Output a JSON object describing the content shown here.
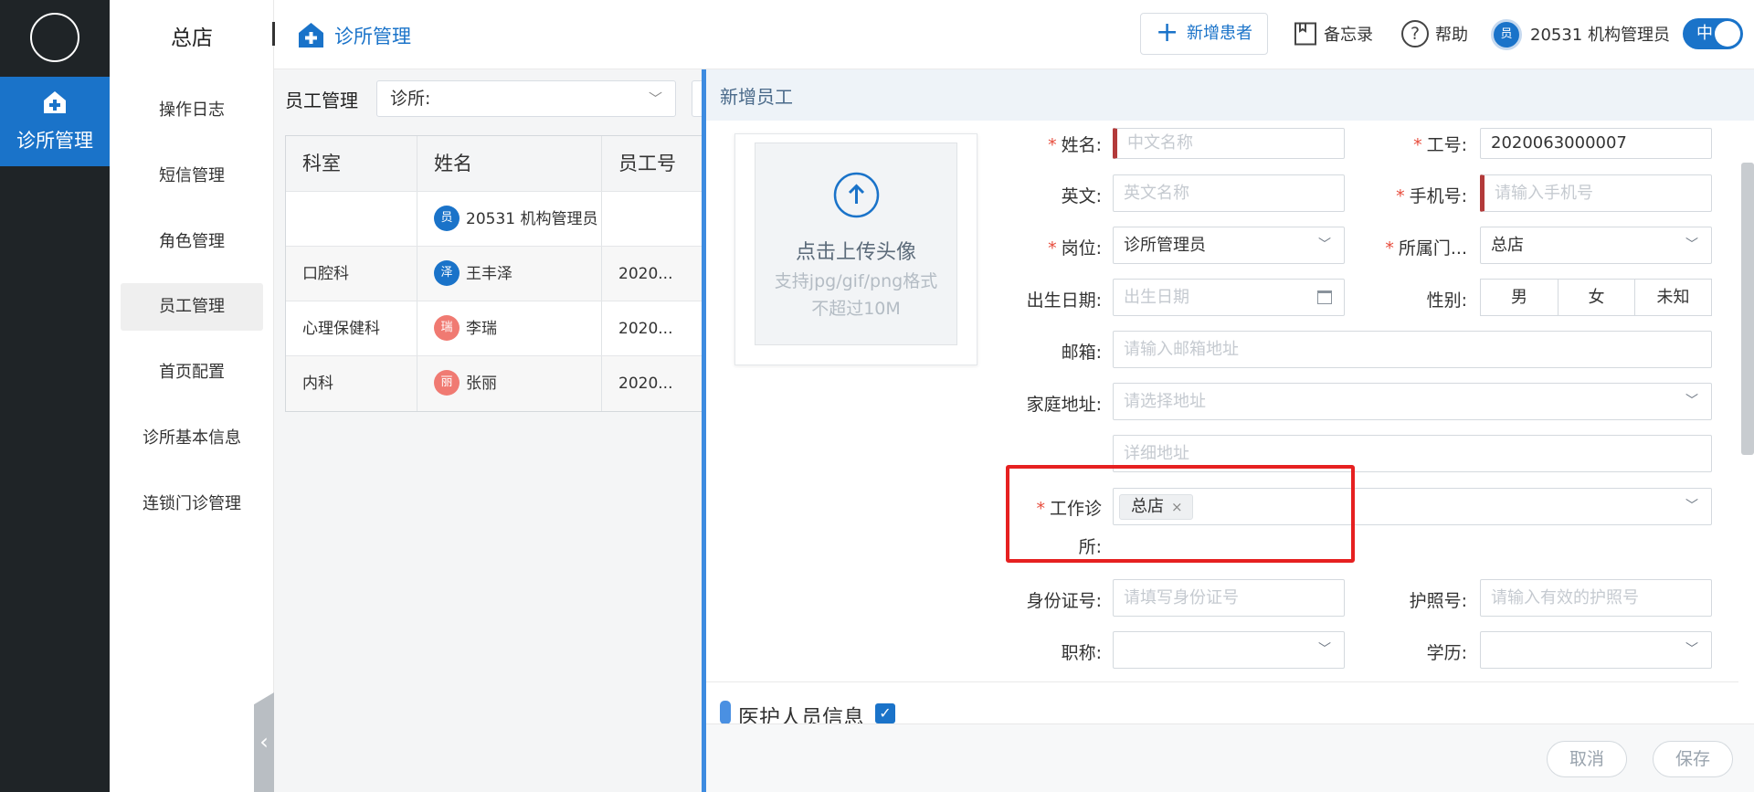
{
  "app": {
    "rail_active_label": "诊所管理",
    "store_name": "总店"
  },
  "sidebar": {
    "items": [
      {
        "label": "操作日志"
      },
      {
        "label": "短信管理"
      },
      {
        "label": "角色管理"
      },
      {
        "label": "员工管理",
        "active": true
      },
      {
        "label": "首页配置"
      },
      {
        "label": "诊所基本信息"
      },
      {
        "label": "连锁门诊管理"
      }
    ]
  },
  "header": {
    "breadcrumb": "诊所管理",
    "new_patient": "新增患者",
    "memo": "备忘录",
    "help": "帮助",
    "help_glyph": "?",
    "user_avatar": "员",
    "user": "20531 机构管理员",
    "lang": "中"
  },
  "staff_list": {
    "title": "员工管理",
    "clinic_filter": "诊所:",
    "columns": [
      "科室",
      "姓名",
      "员工号"
    ],
    "rows": [
      {
        "dept": "",
        "avatar": "员",
        "name": "20531 机构管理员",
        "id": ""
      },
      {
        "dept": "口腔科",
        "avatar": "泽",
        "name": "王丰泽",
        "id": "2020..."
      },
      {
        "dept": "心理保健科",
        "avatar": "瑞",
        "name": "李瑞",
        "id": "2020..."
      },
      {
        "dept": "内科",
        "avatar": "丽",
        "name": "张丽",
        "id": "2020..."
      }
    ]
  },
  "drawer": {
    "title": "新增员工",
    "upload": {
      "title": "点击上传头像",
      "hint1": "支持jpg/gif/png格式",
      "hint2": "不超过10M"
    },
    "form": {
      "name": {
        "label": "姓名:",
        "placeholder": "中文名称"
      },
      "employee_no": {
        "label": "工号:",
        "value": "2020063000007"
      },
      "english": {
        "label": "英文:",
        "placeholder": "英文名称"
      },
      "phone": {
        "label": "手机号:",
        "placeholder": "请输入手机号"
      },
      "position": {
        "label": "岗位:",
        "value": "诊所管理员"
      },
      "store": {
        "label": "所属门...",
        "value": "总店"
      },
      "birth": {
        "label": "出生日期:",
        "placeholder": "出生日期"
      },
      "gender": {
        "label": "性别:",
        "options": [
          "男",
          "女",
          "未知"
        ]
      },
      "email": {
        "label": "邮箱:",
        "placeholder": "请输入邮箱地址"
      },
      "address": {
        "label": "家庭地址:",
        "placeholder": "请选择地址",
        "detail_placeholder": "详细地址"
      },
      "work_clinic": {
        "label_line1": "工作诊",
        "label_line2": "所:",
        "tag": "总店",
        "tag_close": "×"
      },
      "id_card": {
        "label": "身份证号:",
        "placeholder": "请填写身份证号"
      },
      "passport": {
        "label": "护照号:",
        "placeholder": "请输入有效的护照号"
      },
      "title": {
        "label": "职称:",
        "value": ""
      },
      "education": {
        "label": "学历:",
        "value": ""
      }
    },
    "medical_section": {
      "title": "医护人员信息",
      "checked": true,
      "check_glyph": "✓"
    },
    "footer": {
      "cancel": "取消",
      "save": "保存"
    }
  },
  "icons": {
    "required_mark": "*",
    "chevron": "﹀",
    "collapse": "‹"
  },
  "colors": {
    "primary": "#1a73c9",
    "rail_bg": "#1f2427",
    "required": "#e74c3c",
    "highlight_box": "#e62020"
  }
}
